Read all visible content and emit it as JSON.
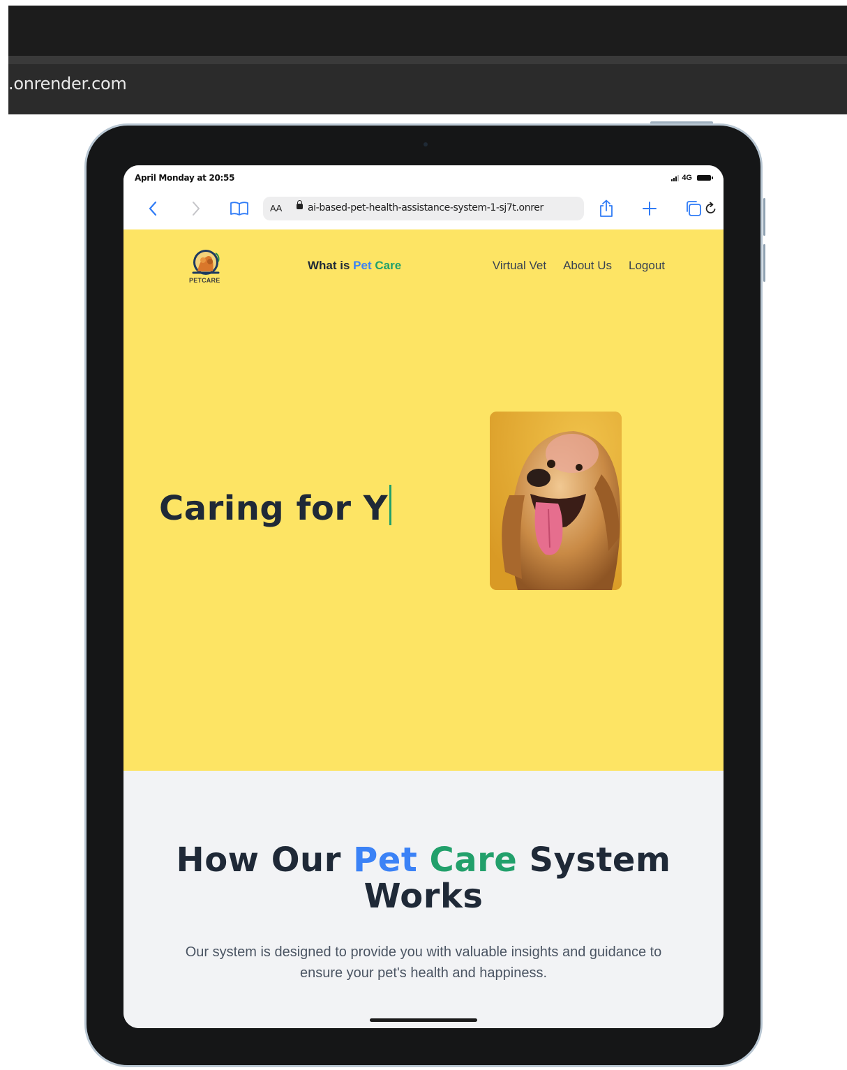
{
  "host_browser": {
    "address": ".onrender.com"
  },
  "status_bar": {
    "time": "April Monday at 20:55",
    "network": "4G"
  },
  "safari": {
    "text_size_label": "AA",
    "url": "ai-based-pet-health-assistance-system-1-sj7t.onrer"
  },
  "site": {
    "logo_text": "PETCARE",
    "nav_center": {
      "prefix": "What is ",
      "pet": "Pet",
      "care": "Care"
    },
    "nav_links": [
      "Virtual Vet",
      "About Us",
      "Logout"
    ],
    "hero_title": "Caring for Y",
    "how_section": {
      "title_part1": "How Our ",
      "title_pet": "Pet",
      "title_care": "Care",
      "title_part2": " System",
      "title_line2": "Works",
      "description": "Our system is designed to provide you with valuable insights and guidance to ensure your pet's health and happiness."
    }
  },
  "colors": {
    "hero_bg": "#fde464",
    "accent_blue": "#3b82f6",
    "accent_green": "#22a06b",
    "section_bg": "#f2f3f5"
  }
}
